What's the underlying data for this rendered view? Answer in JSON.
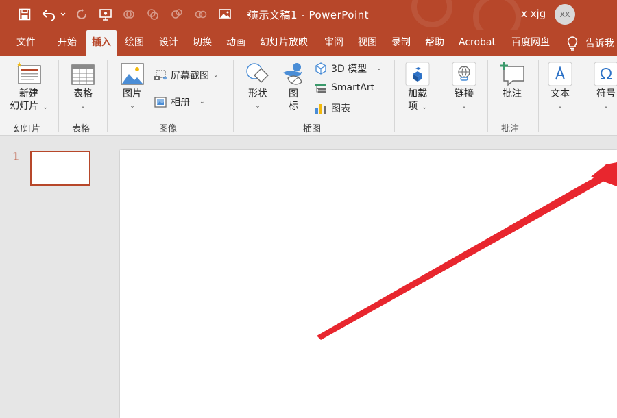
{
  "titlebar": {
    "doc_name": "演示文稿1",
    "separator": " - ",
    "app_name": "PowerPoint",
    "user_name": "x xjg",
    "avatar_initials": "XX",
    "quick_access": [
      "save-icon",
      "undo-icon",
      "redo-icon",
      "present-icon",
      "image-icon",
      "customize-icon"
    ]
  },
  "tabs": [
    {
      "label": "文件"
    },
    {
      "label": "开始"
    },
    {
      "label": "插入",
      "active": true
    },
    {
      "label": "绘图"
    },
    {
      "label": "设计"
    },
    {
      "label": "切换"
    },
    {
      "label": "动画"
    },
    {
      "label": "幻灯片放映"
    },
    {
      "label": "审阅"
    },
    {
      "label": "视图"
    },
    {
      "label": "录制"
    },
    {
      "label": "帮助"
    },
    {
      "label": "Acrobat"
    },
    {
      "label": "百度网盘"
    }
  ],
  "tell_me": "告诉我",
  "ribbon": {
    "new_slide": {
      "line1": "新建",
      "line2": "幻灯片"
    },
    "table": {
      "label": "表格"
    },
    "pictures": {
      "label": "图片"
    },
    "screenshot": {
      "label": "屏幕截图"
    },
    "album": {
      "label": "相册"
    },
    "shapes": {
      "label": "形状"
    },
    "icons": {
      "line1": "图",
      "line2": "标"
    },
    "model3d": {
      "label": "3D 模型"
    },
    "smartart": {
      "label": "SmartArt"
    },
    "chart": {
      "label": "图表"
    },
    "addins": {
      "line1": "加载",
      "line2": "项"
    },
    "link": {
      "label": "链接"
    },
    "comment": {
      "label": "批注"
    },
    "text": {
      "label": "文本"
    },
    "symbols": {
      "label": "符号"
    },
    "groups": {
      "slides": "幻灯片",
      "tables": "表格",
      "images": "图像",
      "illustrations": "插图",
      "comments": "批注"
    }
  },
  "slides_panel": {
    "slide_number": "1"
  },
  "colors": {
    "accent": "#b7472a",
    "annotation_arrow": "#e8262e"
  }
}
